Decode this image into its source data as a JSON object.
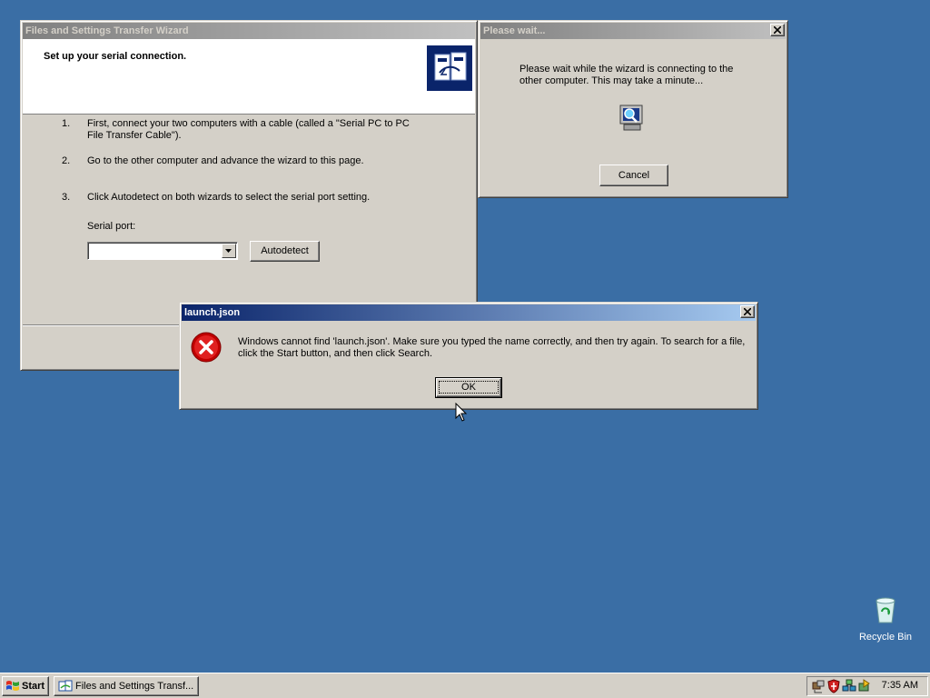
{
  "wizard": {
    "title": "Files and Settings Transfer Wizard",
    "header": "Set up your serial connection.",
    "steps": [
      {
        "num": "1.",
        "text": "First, connect your two computers with a cable (called a \"Serial PC to PC File Transfer Cable\")."
      },
      {
        "num": "2.",
        "text": "Go to the other computer and advance the wizard to this page."
      },
      {
        "num": "3.",
        "text": "Click Autodetect on both wizards to select the serial port setting."
      }
    ],
    "serial_port_label": "Serial port:",
    "serial_port_value": "",
    "autodetect_label": "Autodetect"
  },
  "wait_dialog": {
    "title": "Please wait...",
    "message": "Please wait while the wizard is connecting to the other computer. This may take a minute...",
    "cancel_label": "Cancel"
  },
  "error_dialog": {
    "title": "launch.json",
    "message": "Windows cannot find 'launch.json'. Make sure you typed the name correctly, and then try again. To search for a file, click the Start button, and then click Search.",
    "ok_label": "OK"
  },
  "desktop": {
    "recycle_bin_label": "Recycle Bin"
  },
  "taskbar": {
    "start_label": "Start",
    "task_label": "Files and Settings Transf...",
    "clock": "7:35 AM"
  },
  "colors": {
    "desktop": "#3a6ea5",
    "active_title_start": "#0a246a",
    "active_title_end": "#a6caf0",
    "inactive_title": "#808080",
    "face": "#d4d0c8"
  }
}
